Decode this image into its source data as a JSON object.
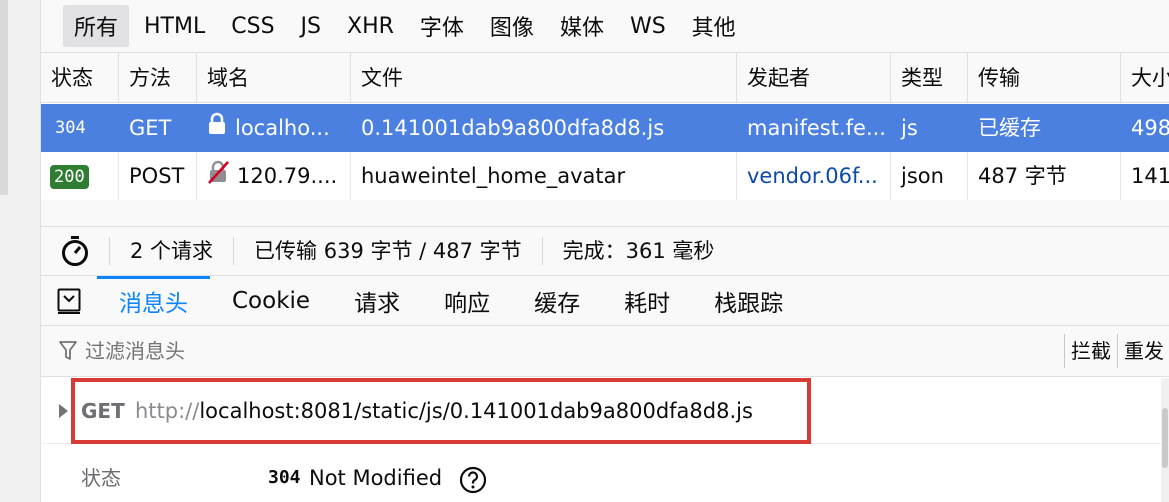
{
  "filters": [
    "所有",
    "HTML",
    "CSS",
    "JS",
    "XHR",
    "字体",
    "图像",
    "媒体",
    "WS",
    "其他"
  ],
  "columns": [
    "状态",
    "方法",
    "域名",
    "文件",
    "发起者",
    "类型",
    "传输",
    "大小"
  ],
  "rows": [
    {
      "status": "304",
      "method": "GET",
      "domain": "localho...",
      "file": "0.141001dab9a800dfa8d8.js",
      "initiator": "manifest.fe...",
      "type": "js",
      "transfer": "已缓存",
      "size": "498"
    },
    {
      "status": "200",
      "method": "POST",
      "domain": "120.79....",
      "file": "huaweintel_home_avatar",
      "initiator": "vendor.06f...",
      "type": "json",
      "transfer": "487 字节",
      "size": "141"
    }
  ],
  "summary": {
    "requests": "2 个请求",
    "transferred": "已传输 639 字节 / 487 字节",
    "finish": "完成：361 毫秒"
  },
  "tabs": [
    "消息头",
    "Cookie",
    "请求",
    "响应",
    "缓存",
    "耗时",
    "栈跟踪"
  ],
  "header_filter": {
    "placeholder": "过滤消息头",
    "block": "拦截",
    "resend": "重发"
  },
  "request": {
    "method": "GET",
    "url_proto": "http://",
    "url_rest": "localhost:8081/static/js/0.141001dab9a800dfa8d8.js"
  },
  "status_line": {
    "label": "状态",
    "code": "304",
    "text": "Not Modified"
  },
  "colors": {
    "selected_row": "#4b7fe0",
    "accent": "#0a84ff",
    "ok_badge": "#2e7d32",
    "highlight": "#d83a34"
  }
}
